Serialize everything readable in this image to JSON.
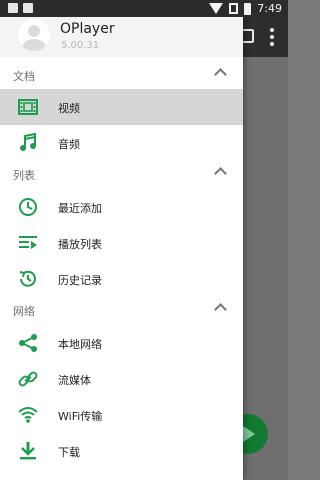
{
  "status_bar": {
    "time": "7:49"
  },
  "app": {
    "name": "OPlayer",
    "version": "5.00.31"
  },
  "sections": [
    {
      "title": "文档",
      "items": [
        {
          "label": "视频",
          "icon": "video-film-icon",
          "active": true
        },
        {
          "label": "音频",
          "icon": "music-note-icon"
        }
      ]
    },
    {
      "title": "列表",
      "items": [
        {
          "label": "最近添加",
          "icon": "clock-icon"
        },
        {
          "label": "播放列表",
          "icon": "playlist-icon"
        },
        {
          "label": "历史记录",
          "icon": "history-icon"
        }
      ]
    },
    {
      "title": "网络",
      "items": [
        {
          "label": "本地网络",
          "icon": "share-icon"
        },
        {
          "label": "流媒体",
          "icon": "link-icon"
        },
        {
          "label": "WiFi传输",
          "icon": "wifi-icon"
        },
        {
          "label": "下载",
          "icon": "download-icon"
        }
      ]
    }
  ],
  "colors": {
    "accent": "#1f9d4f",
    "active_bg": "#d6d6d6"
  }
}
